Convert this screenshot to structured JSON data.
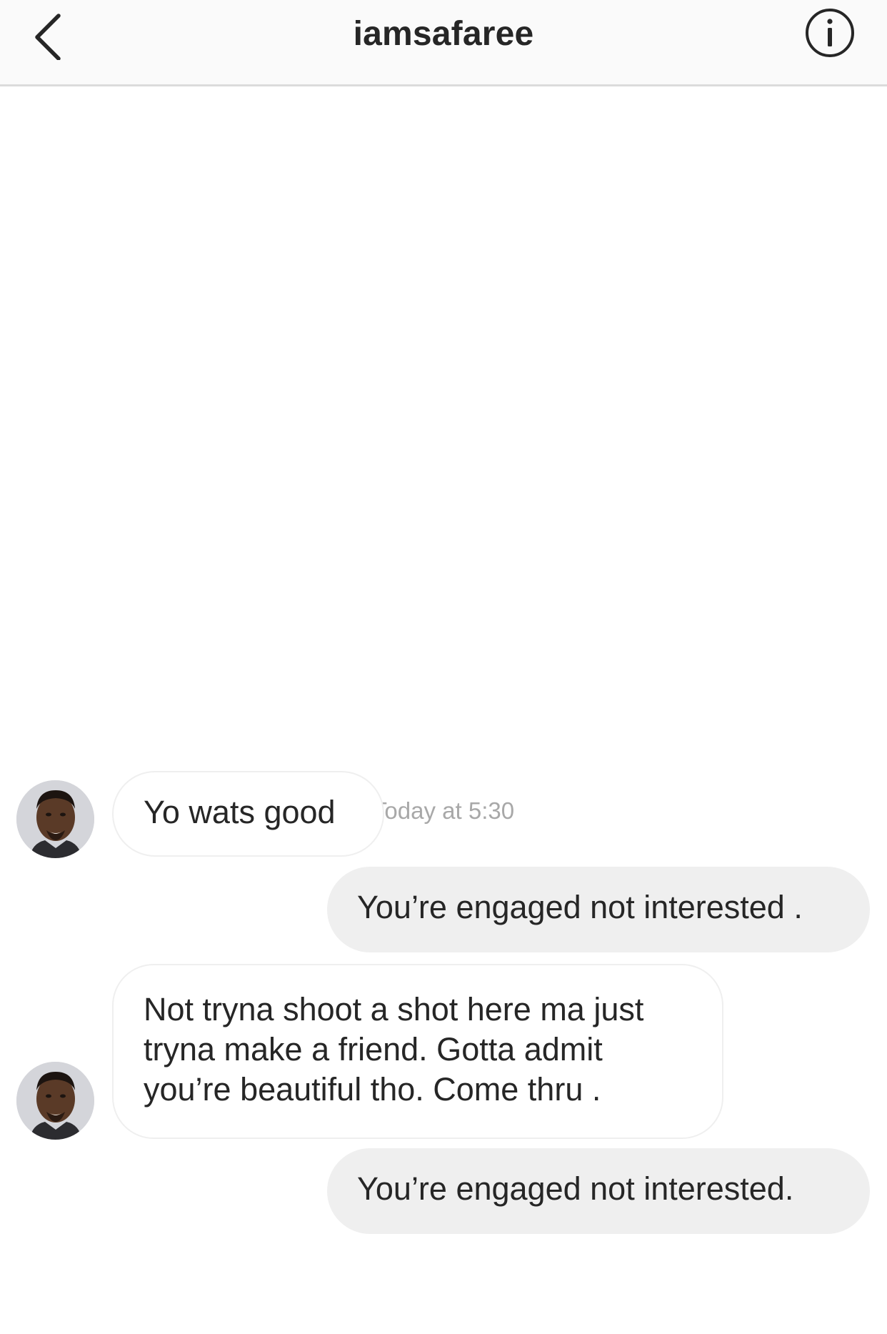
{
  "header": {
    "title": "iamsafaree",
    "back_icon": "chevron-left-icon",
    "info_icon": "info-circle-icon"
  },
  "thread": {
    "timestamp": "Today at 5:30",
    "messages": [
      {
        "sender": "them",
        "text": "Yo wats good"
      },
      {
        "sender": "me",
        "text": "You’re engaged not interested ."
      },
      {
        "sender": "them",
        "text": "Not tryna shoot a shot here ma just tryna make a friend. Gotta admit you’re beautiful tho. Come thru ."
      },
      {
        "sender": "me",
        "text": "You’re engaged not interested."
      }
    ]
  },
  "colors": {
    "header_bg": "#fafafa",
    "divider": "#dbdbdb",
    "outgoing_bubble": "#efefef",
    "incoming_border": "#efefef",
    "timestamp_text": "#a8a8a8",
    "text": "#262626"
  }
}
